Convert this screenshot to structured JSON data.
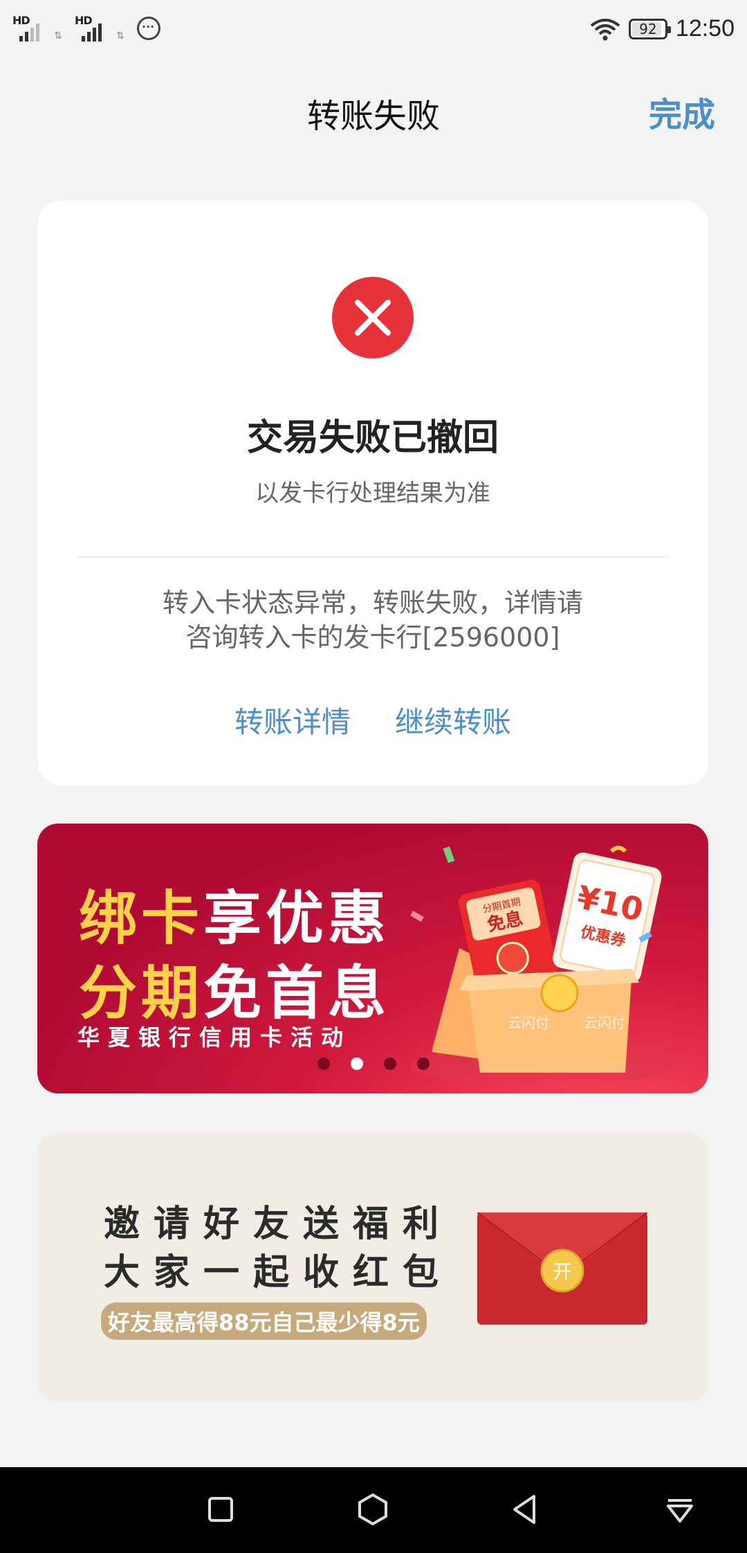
{
  "status_bar": {
    "signal1_label": "HD",
    "signal2_label": "HD",
    "battery": "92",
    "time": "12:50"
  },
  "header": {
    "title": "转账失败",
    "done_label": "完成"
  },
  "result": {
    "icon": "error-x-icon",
    "title": "交易失败已撤回",
    "subtitle": "以发卡行处理结果为准",
    "reason_line1": "转入卡状态异常，转账失败，详情请",
    "reason_line2": "咨询转入卡的发卡行[2596000]",
    "link_details": "转账详情",
    "link_continue": "继续转账",
    "accent": "#4a90c8",
    "error_color": "#e8323a"
  },
  "promo_banner": {
    "line1_a": "绑卡",
    "line1_b": "享优惠",
    "line2_a": "分期",
    "line2_b": "免首息",
    "subtitle": "华夏银行信用卡活动",
    "art_red_packet_top": "分期首期",
    "art_red_packet": "免息",
    "art_coupon_value": "¥10",
    "art_coupon_label": "优惠券",
    "art_box_brand": "云闪付",
    "carousel_count": 4,
    "carousel_active": 2
  },
  "invite_banner": {
    "line1": "邀请好友送福利",
    "line2": "大家一起收红包",
    "pill": "好友最高得88元自己最少得8元",
    "envelope_seal": "开"
  },
  "nav_bar": {
    "items": [
      "recent-apps-icon",
      "home-icon",
      "back-icon",
      "notification-pull-icon"
    ]
  }
}
